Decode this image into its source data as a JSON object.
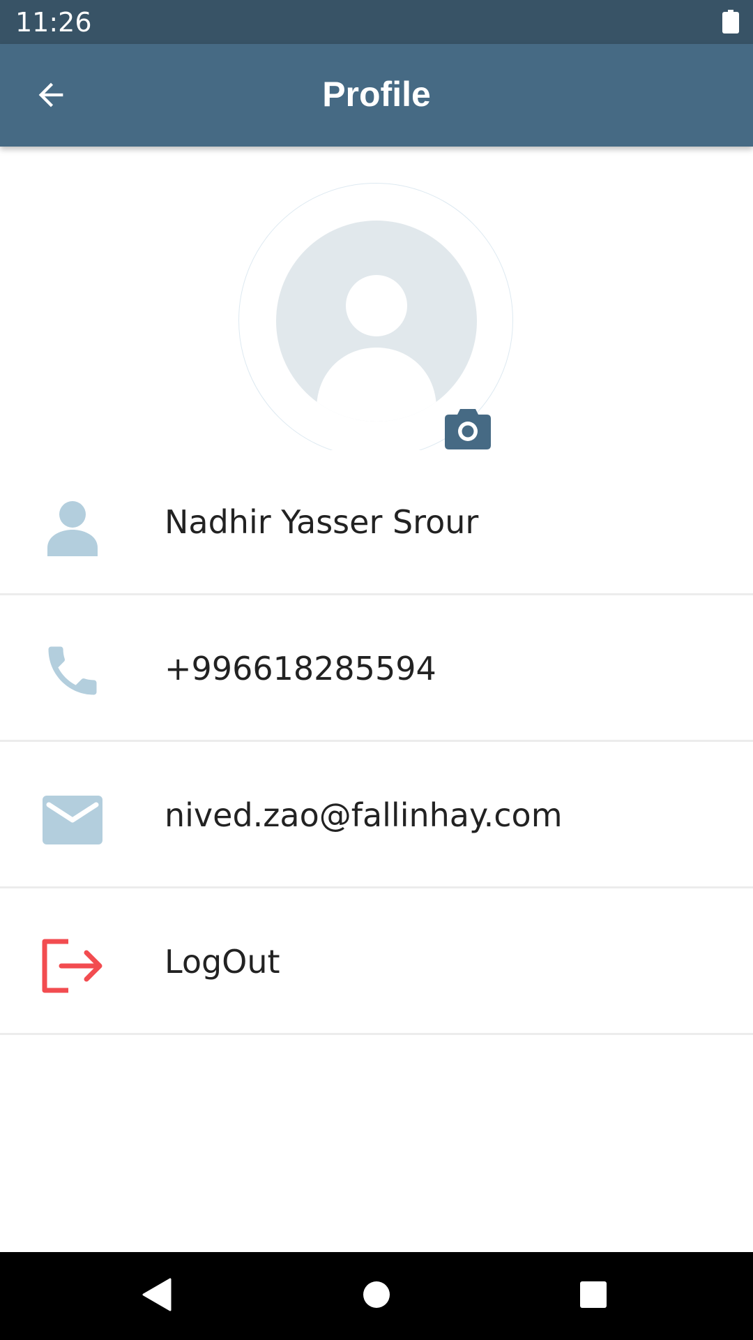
{
  "status_bar": {
    "time": "11:26",
    "battery_icon": "battery-full-icon"
  },
  "app_bar": {
    "title": "Profile",
    "back_icon": "arrow-left-icon"
  },
  "avatar": {
    "placeholder_icon": "person-placeholder-icon",
    "camera_icon": "camera-icon"
  },
  "profile": {
    "rows": [
      {
        "icon": "person-icon",
        "text": "Nadhir Yasser Srour"
      },
      {
        "icon": "phone-icon",
        "text": "+996618285594"
      },
      {
        "icon": "email-icon",
        "text": "nived.zao@fallinhay.com"
      },
      {
        "icon": "logout-icon",
        "text": "LogOut"
      }
    ]
  },
  "nav_bar": {
    "back_icon": "nav-back-icon",
    "home_icon": "nav-home-icon",
    "recents_icon": "nav-recents-icon"
  },
  "colors": {
    "status_bar": "#385366",
    "app_bar": "#466a84",
    "icon_light": "#b3cedd",
    "logout_red": "#f24c50",
    "avatar_bg": "#e1e8ec"
  }
}
